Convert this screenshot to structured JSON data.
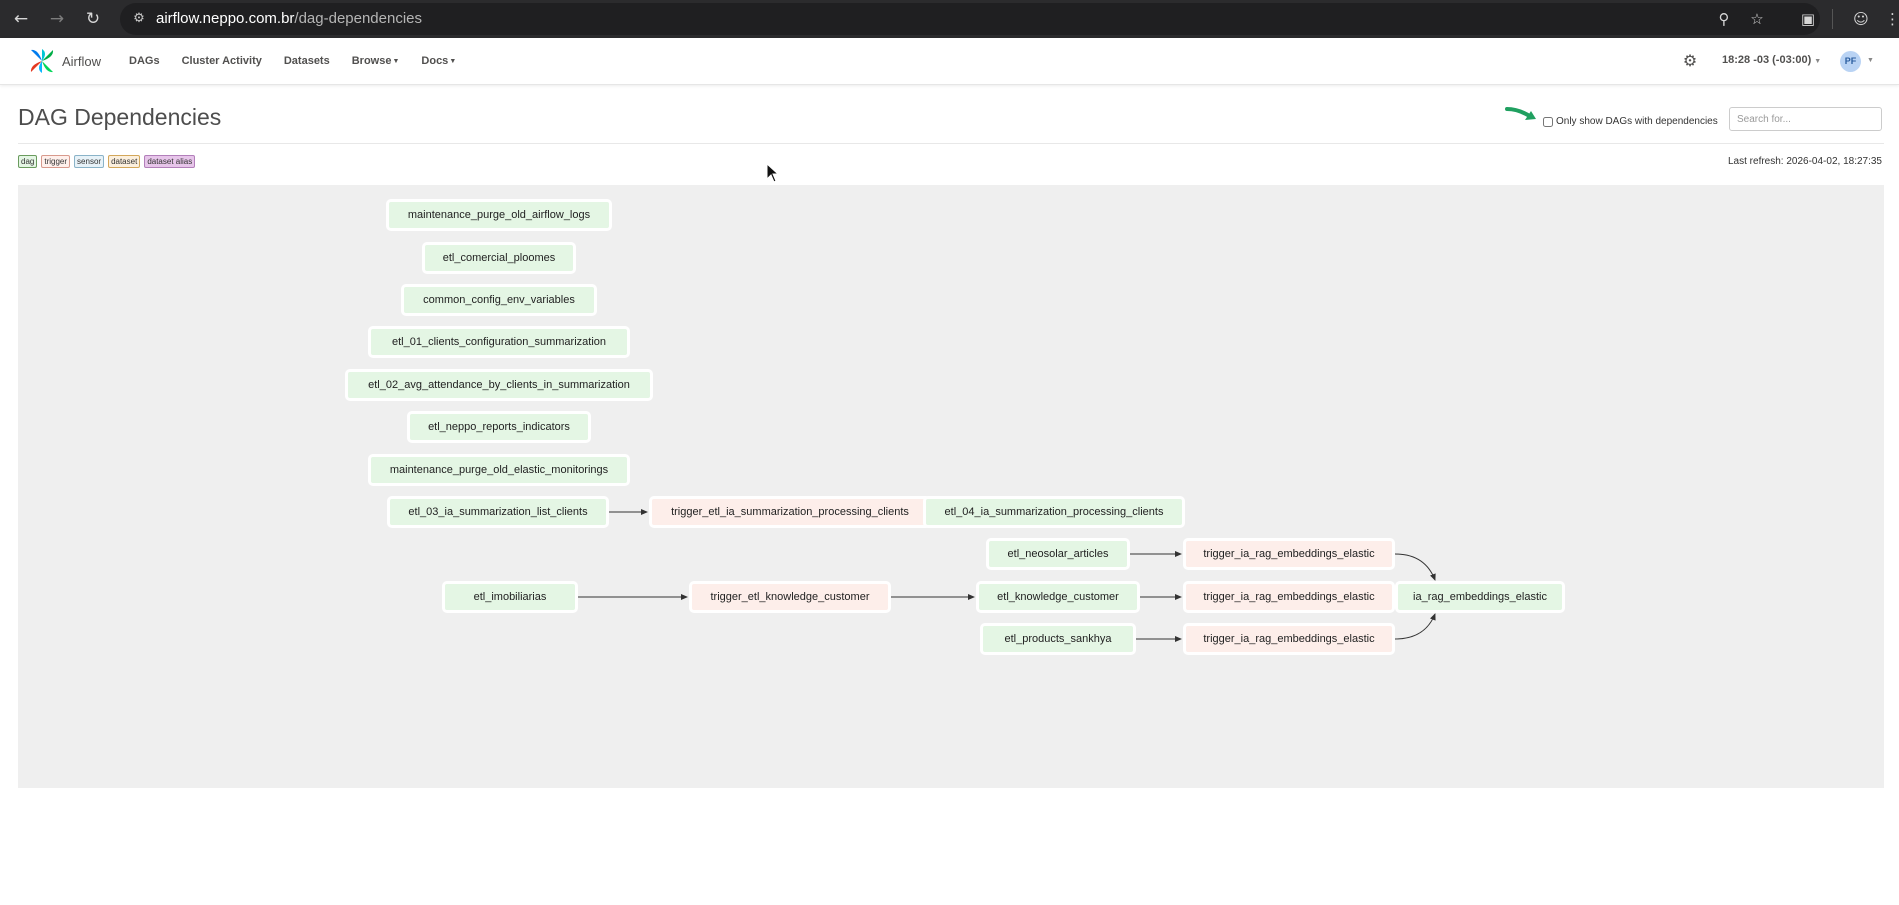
{
  "browser": {
    "url_host": "airflow.neppo.com.br",
    "url_path": "/dag-dependencies"
  },
  "navbar": {
    "brand": "Airflow",
    "menu": [
      {
        "label": "DAGs",
        "has_caret": false
      },
      {
        "label": "Cluster Activity",
        "has_caret": false
      },
      {
        "label": "Datasets",
        "has_caret": false
      },
      {
        "label": "Browse",
        "has_caret": true
      },
      {
        "label": "Docs",
        "has_caret": true
      }
    ],
    "time": "18:28 -03 (-03:00)",
    "user_initials": "PF"
  },
  "page": {
    "title": "DAG Dependencies",
    "filter_label": "Only show DAGs with dependencies",
    "search_placeholder": "Search for...",
    "last_refresh": "Last refresh: 2026-04-02, 18:27:35"
  },
  "legend": [
    "dag",
    "trigger",
    "sensor",
    "dataset",
    "dataset alias"
  ],
  "graph": {
    "nodes": {
      "n1": {
        "label": "maintenance_purge_old_airflow_logs",
        "kind": "dag"
      },
      "n2": {
        "label": "etl_comercial_ploomes",
        "kind": "dag"
      },
      "n3": {
        "label": "common_config_env_variables",
        "kind": "dag"
      },
      "n4": {
        "label": "etl_01_clients_configuration_summarization",
        "kind": "dag"
      },
      "n5": {
        "label": "etl_02_avg_attendance_by_clients_in_summarization",
        "kind": "dag"
      },
      "n6": {
        "label": "etl_neppo_reports_indicators",
        "kind": "dag"
      },
      "n7": {
        "label": "maintenance_purge_old_elastic_monitorings",
        "kind": "dag"
      },
      "n8": {
        "label": "etl_03_ia_summarization_list_clients",
        "kind": "dag"
      },
      "n9": {
        "label": "trigger_etl_ia_summarization_processing_clients",
        "kind": "trigger"
      },
      "n10": {
        "label": "etl_04_ia_summarization_processing_clients",
        "kind": "dag"
      },
      "n11": {
        "label": "etl_neosolar_articles",
        "kind": "dag"
      },
      "n12": {
        "label": "trigger_ia_rag_embeddings_elastic",
        "kind": "trigger"
      },
      "n13": {
        "label": "etl_imobiliarias",
        "kind": "dag"
      },
      "n14": {
        "label": "trigger_etl_knowledge_customer",
        "kind": "trigger"
      },
      "n15": {
        "label": "etl_knowledge_customer",
        "kind": "dag"
      },
      "n16": {
        "label": "trigger_ia_rag_embeddings_elastic",
        "kind": "trigger"
      },
      "n17": {
        "label": "ia_rag_embeddings_elastic",
        "kind": "dag"
      },
      "n18": {
        "label": "etl_products_sankhya",
        "kind": "dag"
      },
      "n19": {
        "label": "trigger_ia_rag_embeddings_elastic",
        "kind": "trigger"
      }
    },
    "edges": [
      [
        "n8",
        "n9"
      ],
      [
        "n9",
        "n10"
      ],
      [
        "n11",
        "n12"
      ],
      [
        "n12",
        "n17"
      ],
      [
        "n13",
        "n14"
      ],
      [
        "n14",
        "n15"
      ],
      [
        "n15",
        "n16"
      ],
      [
        "n16",
        "n17"
      ],
      [
        "n18",
        "n19"
      ],
      [
        "n19",
        "n17"
      ]
    ]
  }
}
